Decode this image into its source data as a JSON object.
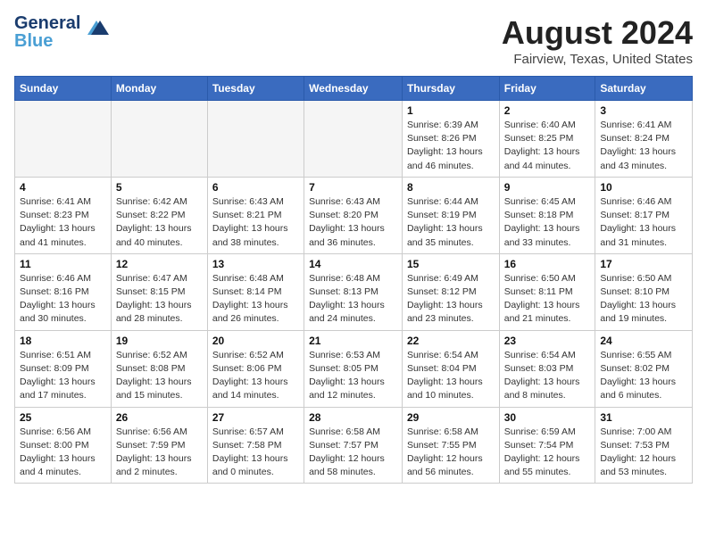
{
  "header": {
    "logo_line1": "General",
    "logo_line2": "Blue",
    "month": "August 2024",
    "location": "Fairview, Texas, United States"
  },
  "weekdays": [
    "Sunday",
    "Monday",
    "Tuesday",
    "Wednesday",
    "Thursday",
    "Friday",
    "Saturday"
  ],
  "weeks": [
    [
      {
        "day": "",
        "info": ""
      },
      {
        "day": "",
        "info": ""
      },
      {
        "day": "",
        "info": ""
      },
      {
        "day": "",
        "info": ""
      },
      {
        "day": "1",
        "info": "Sunrise: 6:39 AM\nSunset: 8:26 PM\nDaylight: 13 hours and 46 minutes."
      },
      {
        "day": "2",
        "info": "Sunrise: 6:40 AM\nSunset: 8:25 PM\nDaylight: 13 hours and 44 minutes."
      },
      {
        "day": "3",
        "info": "Sunrise: 6:41 AM\nSunset: 8:24 PM\nDaylight: 13 hours and 43 minutes."
      }
    ],
    [
      {
        "day": "4",
        "info": "Sunrise: 6:41 AM\nSunset: 8:23 PM\nDaylight: 13 hours and 41 minutes."
      },
      {
        "day": "5",
        "info": "Sunrise: 6:42 AM\nSunset: 8:22 PM\nDaylight: 13 hours and 40 minutes."
      },
      {
        "day": "6",
        "info": "Sunrise: 6:43 AM\nSunset: 8:21 PM\nDaylight: 13 hours and 38 minutes."
      },
      {
        "day": "7",
        "info": "Sunrise: 6:43 AM\nSunset: 8:20 PM\nDaylight: 13 hours and 36 minutes."
      },
      {
        "day": "8",
        "info": "Sunrise: 6:44 AM\nSunset: 8:19 PM\nDaylight: 13 hours and 35 minutes."
      },
      {
        "day": "9",
        "info": "Sunrise: 6:45 AM\nSunset: 8:18 PM\nDaylight: 13 hours and 33 minutes."
      },
      {
        "day": "10",
        "info": "Sunrise: 6:46 AM\nSunset: 8:17 PM\nDaylight: 13 hours and 31 minutes."
      }
    ],
    [
      {
        "day": "11",
        "info": "Sunrise: 6:46 AM\nSunset: 8:16 PM\nDaylight: 13 hours and 30 minutes."
      },
      {
        "day": "12",
        "info": "Sunrise: 6:47 AM\nSunset: 8:15 PM\nDaylight: 13 hours and 28 minutes."
      },
      {
        "day": "13",
        "info": "Sunrise: 6:48 AM\nSunset: 8:14 PM\nDaylight: 13 hours and 26 minutes."
      },
      {
        "day": "14",
        "info": "Sunrise: 6:48 AM\nSunset: 8:13 PM\nDaylight: 13 hours and 24 minutes."
      },
      {
        "day": "15",
        "info": "Sunrise: 6:49 AM\nSunset: 8:12 PM\nDaylight: 13 hours and 23 minutes."
      },
      {
        "day": "16",
        "info": "Sunrise: 6:50 AM\nSunset: 8:11 PM\nDaylight: 13 hours and 21 minutes."
      },
      {
        "day": "17",
        "info": "Sunrise: 6:50 AM\nSunset: 8:10 PM\nDaylight: 13 hours and 19 minutes."
      }
    ],
    [
      {
        "day": "18",
        "info": "Sunrise: 6:51 AM\nSunset: 8:09 PM\nDaylight: 13 hours and 17 minutes."
      },
      {
        "day": "19",
        "info": "Sunrise: 6:52 AM\nSunset: 8:08 PM\nDaylight: 13 hours and 15 minutes."
      },
      {
        "day": "20",
        "info": "Sunrise: 6:52 AM\nSunset: 8:06 PM\nDaylight: 13 hours and 14 minutes."
      },
      {
        "day": "21",
        "info": "Sunrise: 6:53 AM\nSunset: 8:05 PM\nDaylight: 13 hours and 12 minutes."
      },
      {
        "day": "22",
        "info": "Sunrise: 6:54 AM\nSunset: 8:04 PM\nDaylight: 13 hours and 10 minutes."
      },
      {
        "day": "23",
        "info": "Sunrise: 6:54 AM\nSunset: 8:03 PM\nDaylight: 13 hours and 8 minutes."
      },
      {
        "day": "24",
        "info": "Sunrise: 6:55 AM\nSunset: 8:02 PM\nDaylight: 13 hours and 6 minutes."
      }
    ],
    [
      {
        "day": "25",
        "info": "Sunrise: 6:56 AM\nSunset: 8:00 PM\nDaylight: 13 hours and 4 minutes."
      },
      {
        "day": "26",
        "info": "Sunrise: 6:56 AM\nSunset: 7:59 PM\nDaylight: 13 hours and 2 minutes."
      },
      {
        "day": "27",
        "info": "Sunrise: 6:57 AM\nSunset: 7:58 PM\nDaylight: 13 hours and 0 minutes."
      },
      {
        "day": "28",
        "info": "Sunrise: 6:58 AM\nSunset: 7:57 PM\nDaylight: 12 hours and 58 minutes."
      },
      {
        "day": "29",
        "info": "Sunrise: 6:58 AM\nSunset: 7:55 PM\nDaylight: 12 hours and 56 minutes."
      },
      {
        "day": "30",
        "info": "Sunrise: 6:59 AM\nSunset: 7:54 PM\nDaylight: 12 hours and 55 minutes."
      },
      {
        "day": "31",
        "info": "Sunrise: 7:00 AM\nSunset: 7:53 PM\nDaylight: 12 hours and 53 minutes."
      }
    ]
  ]
}
